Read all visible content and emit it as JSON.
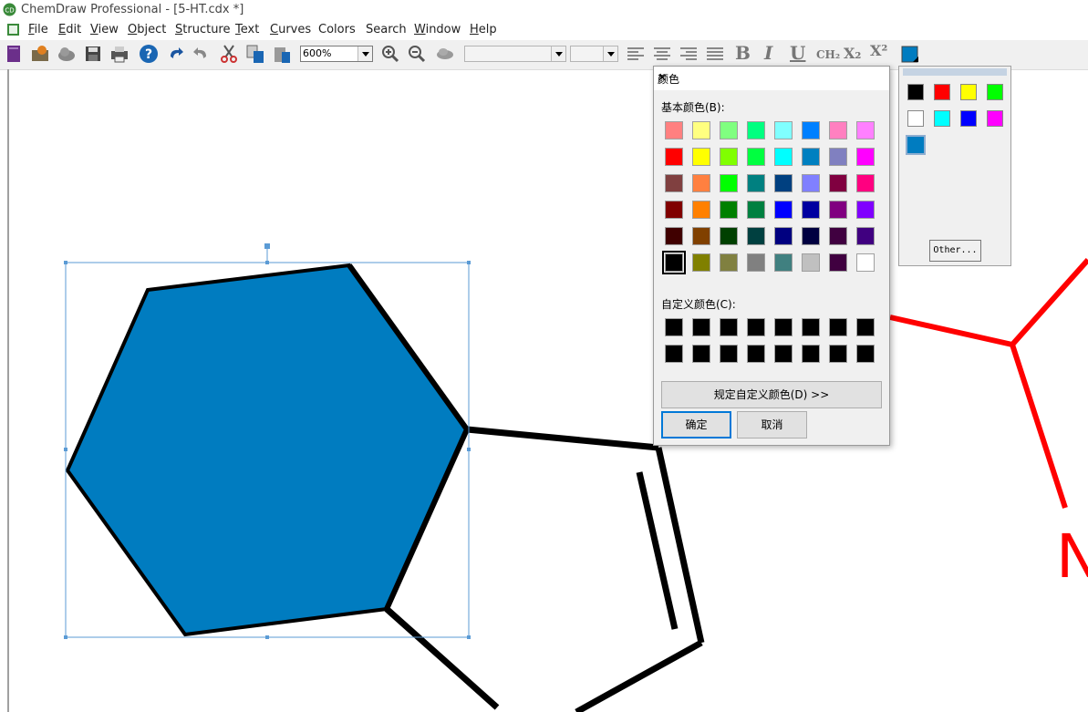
{
  "window": {
    "title": "ChemDraw Professional - [5-HT.cdx *]"
  },
  "menu": [
    {
      "label": "File",
      "u": "F",
      "rest": "ile"
    },
    {
      "label": "Edit",
      "u": "E",
      "rest": "dit"
    },
    {
      "label": "View",
      "u": "V",
      "rest": "iew"
    },
    {
      "label": "Object",
      "u": "O",
      "rest": "bject"
    },
    {
      "label": "Structure",
      "u": "S",
      "rest": "tructure"
    },
    {
      "label": "Text",
      "u": "T",
      "rest": "ext"
    },
    {
      "label": "Curves",
      "u": "C",
      "rest": "urves"
    },
    {
      "label": "Colors",
      "u": "",
      "rest": "Colors"
    },
    {
      "label": "Search",
      "u": "",
      "rest": "Search"
    },
    {
      "label": "Window",
      "u": "W",
      "rest": "indow"
    },
    {
      "label": "Help",
      "u": "H",
      "rest": "elp"
    }
  ],
  "toolbar": {
    "zoom_value": "600%",
    "icons": [
      "new-document-icon",
      "open-icon",
      "cloud-icon",
      "save-icon",
      "print-icon",
      "help-icon",
      "undo-icon",
      "redo-icon",
      "cut-icon",
      "copy-icon",
      "paste-icon",
      "zoom-in-icon",
      "zoom-out-icon",
      "cloud-sync-icon",
      "align-left-icon",
      "align-center-icon",
      "align-right-icon",
      "justify-icon",
      "bold-icon",
      "italic-icon",
      "underline-icon",
      "formula-icon",
      "subscript-icon",
      "superscript-icon",
      "color-icon"
    ],
    "bold_label": "B",
    "italic_label": "I",
    "underline_label": "U",
    "formula_label": "CH₂",
    "subscript_label": "X₂",
    "superscript_label": "X²"
  },
  "canvas": {
    "selected_fill_color": "#007cc0",
    "bond_color": "#000000",
    "highlight_color": "#ff0000",
    "atom_label": "N"
  },
  "color_dialog": {
    "title": "颜色",
    "basic_label": "基本颜色(B):",
    "custom_label": "自定义颜色(C):",
    "define_custom_button": "规定自定义颜色(D) >>",
    "ok_button": "确定",
    "cancel_button": "取消",
    "basic_colors": [
      [
        "#ff8080",
        "#ffff80",
        "#80ff80",
        "#00ff80",
        "#80ffff",
        "#0080ff",
        "#ff80c0",
        "#ff80ff"
      ],
      [
        "#ff0000",
        "#ffff00",
        "#80ff00",
        "#00ff40",
        "#00ffff",
        "#0080c0",
        "#8080c0",
        "#ff00ff"
      ],
      [
        "#804040",
        "#ff8040",
        "#00ff00",
        "#008080",
        "#004080",
        "#8080ff",
        "#800040",
        "#ff0080"
      ],
      [
        "#800000",
        "#ff8000",
        "#008000",
        "#008040",
        "#0000ff",
        "#0000a0",
        "#800080",
        "#8000ff"
      ],
      [
        "#400000",
        "#804000",
        "#004000",
        "#004040",
        "#000080",
        "#000040",
        "#400040",
        "#400080"
      ],
      [
        "#000000",
        "#808000",
        "#808040",
        "#808080",
        "#408080",
        "#c0c0c0",
        "#400040",
        "#ffffff"
      ]
    ],
    "selected_basic": "#000000",
    "custom_colors": [
      [
        "#000000",
        "#000000",
        "#000000",
        "#000000",
        "#000000",
        "#000000",
        "#000000",
        "#000000"
      ],
      [
        "#000000",
        "#000000",
        "#000000",
        "#000000",
        "#000000",
        "#000000",
        "#000000",
        "#000000"
      ]
    ]
  },
  "palette": {
    "colors": [
      "#000000",
      "#ff0000",
      "#ffff00",
      "#00ff00",
      "#ffffff",
      "#00ffff",
      "#0000ff",
      "#ff00ff"
    ],
    "current": "#007cc0",
    "other_button": "Other..."
  }
}
